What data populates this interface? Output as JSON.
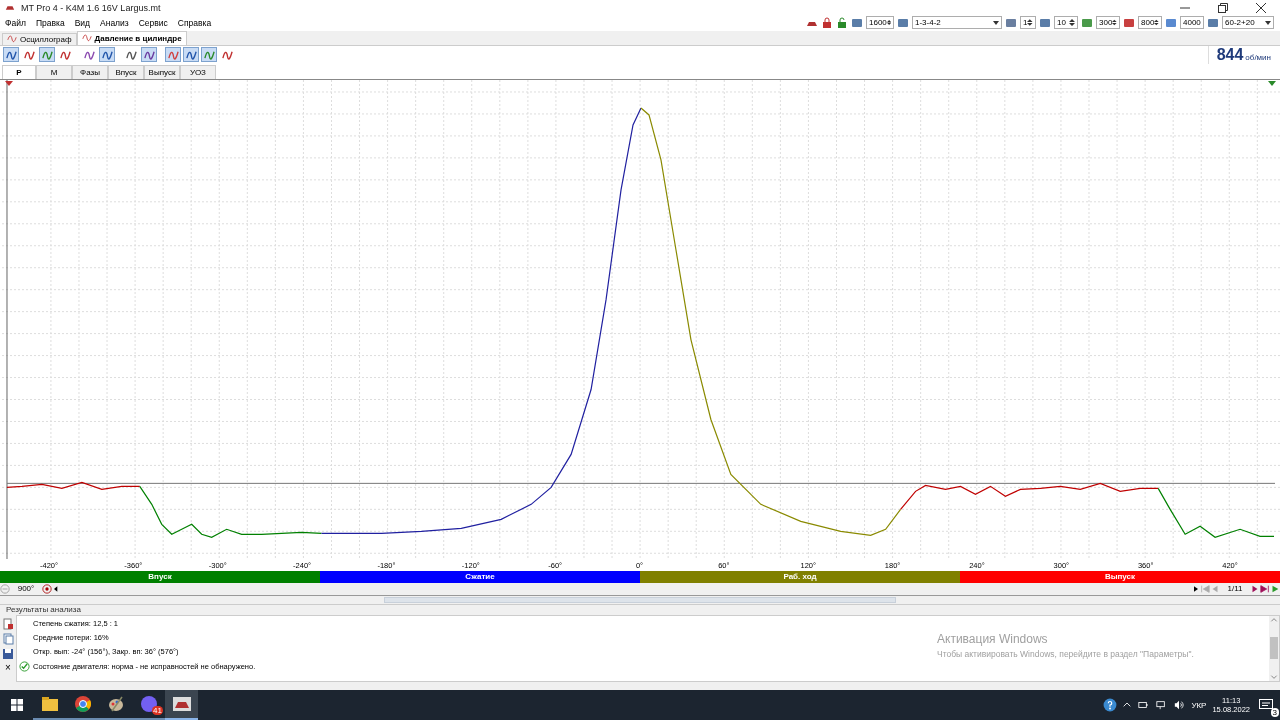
{
  "window": {
    "title": "MT Pro 4 - K4M 1.6 16V Largus.mt"
  },
  "menu": [
    "Файл",
    "Правка",
    "Вид",
    "Анализ",
    "Сервис",
    "Справка"
  ],
  "top_toolbar": [
    {
      "kind": "spin",
      "value": "1600"
    },
    {
      "kind": "combo",
      "value": "1-3-4-2"
    },
    {
      "kind": "spin",
      "value": "1"
    },
    {
      "kind": "spin",
      "value": "10"
    },
    {
      "kind": "spin",
      "value": "300"
    },
    {
      "kind": "spin",
      "value": "800"
    },
    {
      "kind": "spin",
      "value": "4000"
    },
    {
      "kind": "combo",
      "value": "60-2+20"
    }
  ],
  "document_tabs": [
    {
      "label": "Осциллограф",
      "selected": false
    },
    {
      "label": "Давление в цилиндре",
      "selected": true
    }
  ],
  "tool_buttons": [
    {
      "pressed": true
    },
    {
      "pressed": false
    },
    {
      "pressed": true
    },
    {
      "pressed": false
    },
    {
      "pressed": false
    },
    {
      "pressed": true
    },
    {
      "pressed": false
    },
    {
      "pressed": true
    },
    {
      "pressed": true
    },
    {
      "pressed": true
    },
    {
      "pressed": true
    },
    {
      "pressed": false
    }
  ],
  "rpm": {
    "value": "844",
    "unit": "об/мин"
  },
  "view_tabs": [
    {
      "label": "P",
      "selected": true
    },
    {
      "label": "M",
      "selected": false
    },
    {
      "label": "Фазы",
      "selected": false
    },
    {
      "label": "Впуск",
      "selected": false
    },
    {
      "label": "Выпуск",
      "selected": false
    },
    {
      "label": "УОЗ",
      "selected": false
    }
  ],
  "x_axis_labels": [
    "-420°",
    "-360°",
    "-300°",
    "-240°",
    "-180°",
    "-120°",
    "-60°",
    "0°",
    "60°",
    "120°",
    "180°",
    "240°",
    "300°",
    "360°",
    "420°"
  ],
  "phases": [
    {
      "label": "Впуск",
      "color": "#008000"
    },
    {
      "label": "Сжатие",
      "color": "#0000ff"
    },
    {
      "label": "Раб. ход",
      "color": "#808000"
    },
    {
      "label": "Выпуск",
      "color": "#ff0000"
    }
  ],
  "scale": "900°",
  "frame_counter": "1/11",
  "results": {
    "title": "Результаты анализа",
    "lines": [
      "Степень сжатия: 12,5 : 1",
      "Средние потери: 16%",
      "Откр. вып: -24° (156°), Закр. вп: 36° (576°)"
    ],
    "status": "Состояние двигателя: норма - не исправностей не обнаружено.",
    "close": "×"
  },
  "activation": {
    "title": "Активация Windows",
    "text": "Чтобы активировать Windows, перейдите в раздел \"Параметры\"."
  },
  "taskbar": {
    "apps": [
      {
        "kind": "folder",
        "active": false
      },
      {
        "kind": "browser",
        "active": false
      },
      {
        "kind": "palette",
        "active": false
      },
      {
        "kind": "messenger",
        "active": false
      },
      {
        "kind": "car",
        "active": true
      }
    ],
    "badge": "41",
    "language": "УКР",
    "time": "11:13",
    "date": "15.08.2022",
    "notifications": "3"
  }
}
